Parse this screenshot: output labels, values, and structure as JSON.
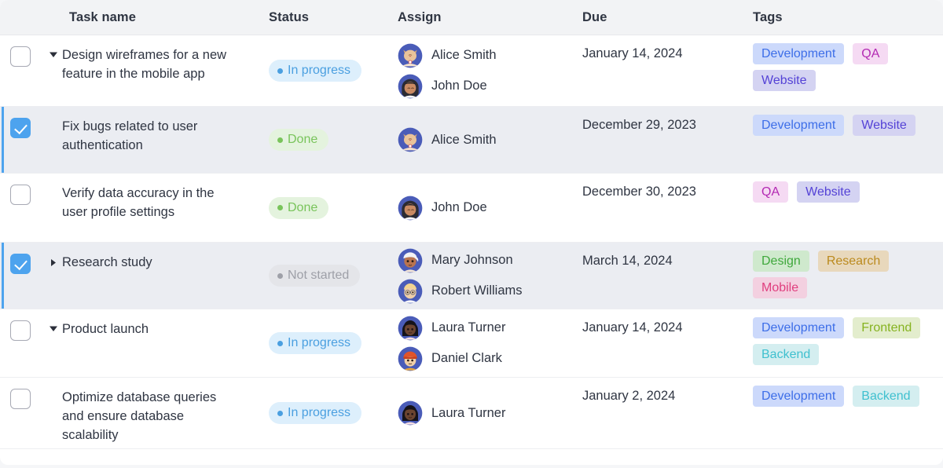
{
  "table": {
    "columns": [
      {
        "key": "check",
        "label": ""
      },
      {
        "key": "task",
        "label": "Task name"
      },
      {
        "key": "status",
        "label": "Status"
      },
      {
        "key": "assign",
        "label": "Assign"
      },
      {
        "key": "due",
        "label": "Due"
      },
      {
        "key": "tags",
        "label": "Tags"
      }
    ],
    "rows": [
      {
        "checked": false,
        "twisty": "expanded",
        "task": "Design wireframes for a new feature in the mobile app",
        "status": {
          "label": "In progress",
          "kind": "inprogress"
        },
        "assignees": [
          {
            "name": "Alice Smith",
            "avatar": "cat-avatar"
          },
          {
            "name": "John Doe",
            "avatar": "john-avatar"
          }
        ],
        "due": "January 14, 2024",
        "tags": [
          {
            "label": "Development",
            "kind": "development"
          },
          {
            "label": "QA",
            "kind": "qa"
          },
          {
            "label": "Website",
            "kind": "website"
          }
        ]
      },
      {
        "checked": true,
        "twisty": "none",
        "task": "Fix bugs related to user authentication",
        "status": {
          "label": "Done",
          "kind": "done"
        },
        "assignees": [
          {
            "name": "Alice Smith",
            "avatar": "cat-avatar"
          }
        ],
        "due": "December 29, 2023",
        "tags": [
          {
            "label": "Development",
            "kind": "development"
          },
          {
            "label": "Website",
            "kind": "website"
          }
        ]
      },
      {
        "checked": false,
        "twisty": "none",
        "task": "Verify data accuracy in the user profile settings",
        "status": {
          "label": "Done",
          "kind": "done"
        },
        "assignees": [
          {
            "name": "John Doe",
            "avatar": "john-avatar"
          }
        ],
        "due": "December 30, 2023",
        "tags": [
          {
            "label": "QA",
            "kind": "qa"
          },
          {
            "label": "Website",
            "kind": "website"
          }
        ]
      },
      {
        "checked": true,
        "twisty": "collapsed",
        "task": "Research study",
        "status": {
          "label": "Not started",
          "kind": "notstarted"
        },
        "assignees": [
          {
            "name": "Mary Johnson",
            "avatar": "mary-avatar"
          },
          {
            "name": "Robert Williams",
            "avatar": "robert-avatar"
          }
        ],
        "due": "March 14, 2024",
        "tags": [
          {
            "label": "Design",
            "kind": "design"
          },
          {
            "label": "Research",
            "kind": "research"
          },
          {
            "label": "Mobile",
            "kind": "mobile"
          }
        ]
      },
      {
        "checked": false,
        "twisty": "expanded",
        "task": "Product launch",
        "status": {
          "label": "In progress",
          "kind": "inprogress"
        },
        "assignees": [
          {
            "name": "Laura Turner",
            "avatar": "laura-avatar"
          },
          {
            "name": "Daniel Clark",
            "avatar": "daniel-avatar"
          }
        ],
        "due": "January 14, 2024",
        "tags": [
          {
            "label": "Development",
            "kind": "development"
          },
          {
            "label": "Frontend",
            "kind": "frontend"
          },
          {
            "label": "Backend",
            "kind": "backend"
          }
        ]
      },
      {
        "checked": false,
        "twisty": "none",
        "task": "Optimize database queries and ensure database scalability",
        "status": {
          "label": "In progress",
          "kind": "inprogress"
        },
        "assignees": [
          {
            "name": "Laura Turner",
            "avatar": "laura-avatar"
          }
        ],
        "due": "January 2, 2024",
        "tags": [
          {
            "label": "Development",
            "kind": "development"
          },
          {
            "label": "Backend",
            "kind": "backend"
          }
        ]
      }
    ]
  },
  "colors": {
    "accent": "#4da3ee",
    "selected_row_bg": "#ebedf2",
    "header_bg": "#f2f3f5",
    "text": "#2f3542"
  }
}
